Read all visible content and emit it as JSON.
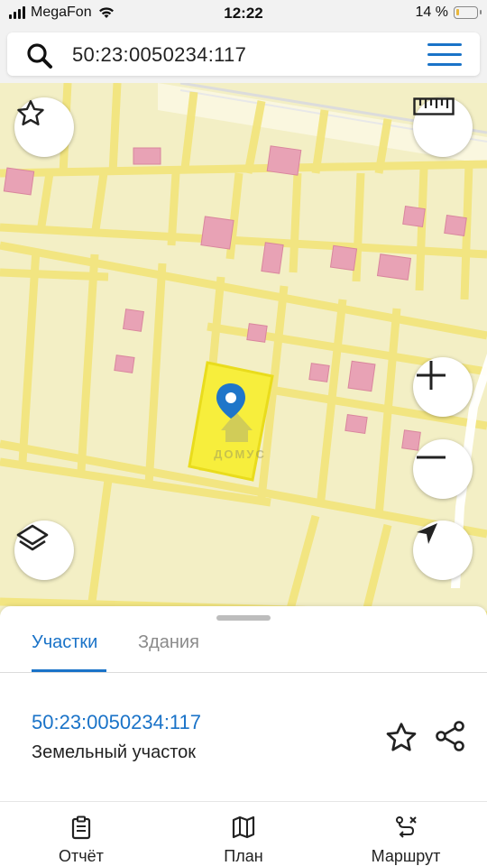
{
  "status_bar": {
    "carrier": "MegaFon",
    "time": "12:22",
    "battery": "14 %",
    "battery_level": 0.14
  },
  "search": {
    "value": "50:23:0050234:117"
  },
  "map": {
    "watermark": "ДОМУС"
  },
  "sheet": {
    "tabs": [
      {
        "label": "Участки",
        "active": true
      },
      {
        "label": "Здания",
        "active": false
      }
    ],
    "result": {
      "cadastral_number": "50:23:0050234:117",
      "type": "Земельный участок"
    }
  },
  "bottom_nav": {
    "items": [
      {
        "label": "Отчёт",
        "icon": "report-icon"
      },
      {
        "label": "План",
        "icon": "map-plan-icon"
      },
      {
        "label": "Маршрут",
        "icon": "route-icon"
      }
    ]
  },
  "colors": {
    "accent": "#1a73c8",
    "parcel_fill": "#f3efc5",
    "parcel_border": "#f2e47a",
    "building": "#e8a2b5",
    "selected_parcel": "#f7ee3c"
  }
}
